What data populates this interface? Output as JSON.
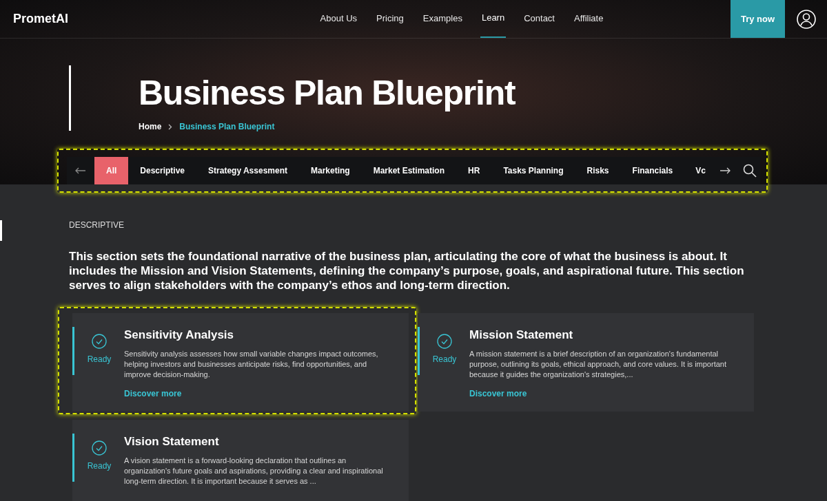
{
  "header": {
    "logo": "PrometAI",
    "nav": [
      {
        "label": "About Us",
        "selected": false
      },
      {
        "label": "Pricing",
        "selected": false
      },
      {
        "label": "Examples",
        "selected": false
      },
      {
        "label": "Learn",
        "selected": true
      },
      {
        "label": "Contact",
        "selected": false
      },
      {
        "label": "Affiliate",
        "selected": false
      }
    ],
    "cta": "Try now"
  },
  "hero": {
    "title": "Business Plan Blueprint",
    "breadcrumb": [
      "Home",
      "Business Plan Blueprint"
    ]
  },
  "categories": [
    {
      "label": "All",
      "selected": true
    },
    {
      "label": "Descriptive",
      "selected": false
    },
    {
      "label": "Strategy Assesment",
      "selected": false
    },
    {
      "label": "Marketing",
      "selected": false
    },
    {
      "label": "Market Estimation",
      "selected": false
    },
    {
      "label": "HR",
      "selected": false
    },
    {
      "label": "Tasks Planning",
      "selected": false
    },
    {
      "label": "Risks",
      "selected": false
    },
    {
      "label": "Financials",
      "selected": false
    },
    {
      "label": "Vc",
      "selected": false
    }
  ],
  "section": {
    "heading": "DESCRIPTIVE",
    "intro": "This section sets the foundational narrative of the business plan, articulating the core of what the business is about. It includes the Mission and Vision Statements, defining the company’s purpose, goals, and aspirational future. This section serves to align stakeholders with the company’s ethos and long-term direction."
  },
  "cards": [
    {
      "title": "Sensitivity Analysis",
      "status": "Ready",
      "highlighted": true,
      "description": "Sensitivity analysis assesses how small variable changes impact outcomes, helping investors and businesses anticipate risks, find opportunities, and improve decision-making.",
      "link": "Discover more"
    },
    {
      "title": "Mission Statement",
      "status": "Ready",
      "highlighted": false,
      "description": "A mission statement is a brief description of an organization's fundamental purpose, outlining its goals, ethical approach, and core values. It is important because it guides the organization's strategies,...",
      "link": "Discover more"
    },
    {
      "title": "Vision Statement",
      "status": "Ready",
      "highlighted": false,
      "description": "A vision statement is a forward-looking declaration that outlines an organization's future goals and aspirations, providing a clear and inspirational long-term direction. It is important because it serves as ..."
    }
  ],
  "category_bar_highlighted": true
}
